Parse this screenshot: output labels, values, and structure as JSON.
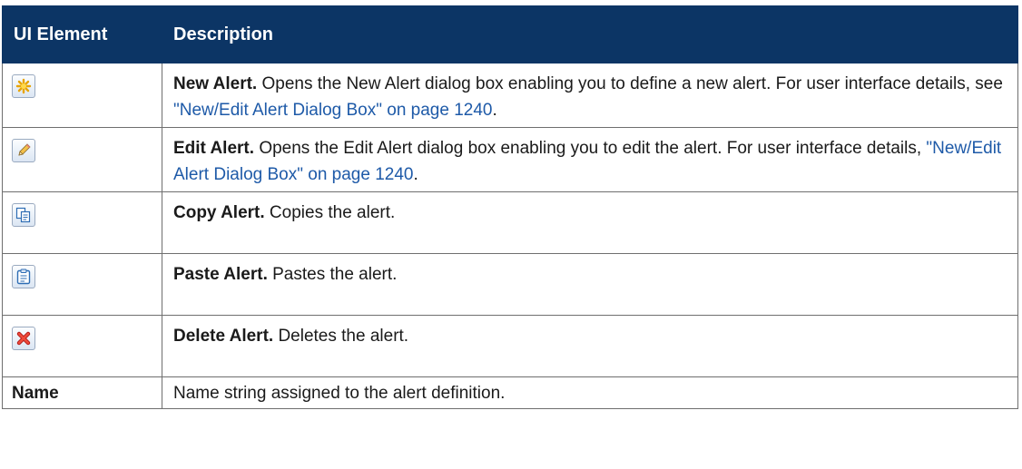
{
  "header": {
    "col1": "UI Element",
    "col2": "Description"
  },
  "rows": [
    {
      "icon": "new-alert-star-icon",
      "name": "New Alert.",
      "desc1": "Opens the New Alert dialog box enabling you to define a new alert. For user interface details, see ",
      "link": "\"New/Edit Alert Dialog Box\" on page 1240",
      "desc2": "."
    },
    {
      "icon": "edit-pencil-icon",
      "name": "Edit Alert.",
      "desc1": "Opens the Edit Alert dialog box enabling you to edit the alert. For user interface details, ",
      "link": "\"New/Edit Alert Dialog Box\" on page 1240",
      "desc2": "."
    },
    {
      "icon": "copy-icon",
      "name": "Copy Alert.",
      "desc1": "Copies the alert."
    },
    {
      "icon": "paste-clipboard-icon",
      "name": "Paste Alert.",
      "desc1": "Pastes the alert."
    },
    {
      "icon": "delete-x-icon",
      "name": "Delete Alert.",
      "desc1": "Deletes the alert."
    },
    {
      "element": "Name",
      "desc1": "Name string assigned to the alert definition."
    }
  ],
  "colors": {
    "header_bg": "#0c3565",
    "link": "#1e5aa8",
    "border": "#6f6f6f"
  }
}
